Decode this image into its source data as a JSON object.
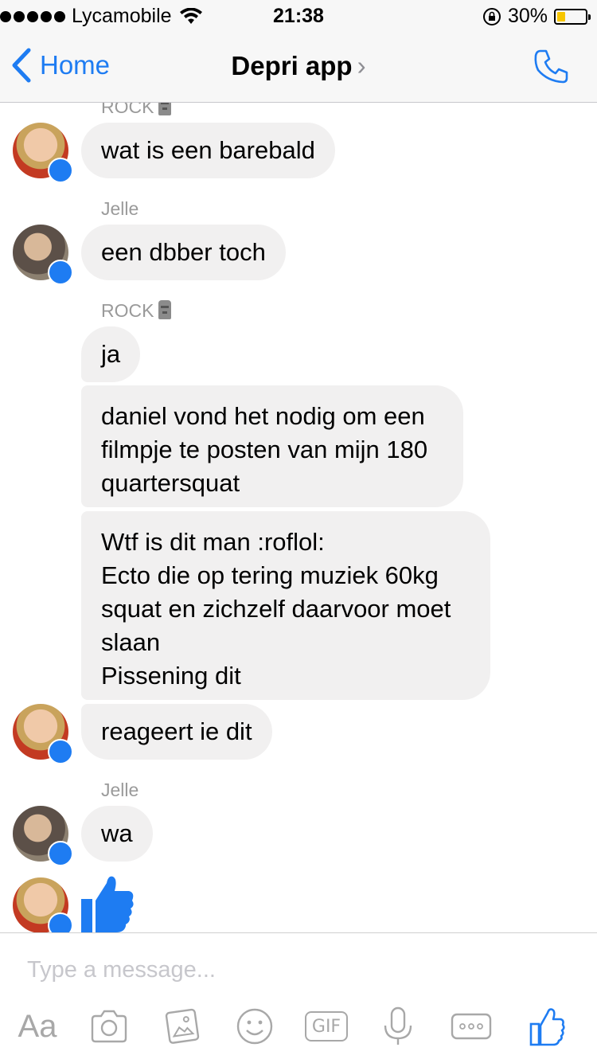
{
  "status_bar": {
    "carrier": "Lycamobile",
    "time": "21:38",
    "battery_percent_label": "30%",
    "battery_level": 0.3,
    "signal_icon": "signal-dots-icon",
    "wifi_icon": "wifi-icon",
    "lock_icon": "rotation-lock-icon"
  },
  "nav": {
    "back_label": "Home",
    "title": "Depri app",
    "chevron": "›",
    "call_icon": "phone-icon"
  },
  "messages": {
    "top_cut_sender": "ROCK",
    "rock_label": "ROCK",
    "jelle_label": "Jelle",
    "m1": "wat is een barebald",
    "m2": "een dbber toch",
    "m3": "ja",
    "m4": [
      "daniel vond het nodig om een",
      "filmpje te posten van mijn 180",
      "quartersquat"
    ],
    "m5": [
      "Wtf is dit man :roflol:",
      "Ecto die op tering muziek 60kg",
      "squat en zichzelf daarvoor moet",
      "slaan",
      "Pissening dit"
    ],
    "m6": "reageert ie dit",
    "m7": "wa",
    "m8_icon": "thumbs-up-icon"
  },
  "composer": {
    "placeholder": "Type a message...",
    "aa_label": "Aa",
    "gif_label": "GIF",
    "icons": [
      "camera-icon",
      "gallery-icon",
      "emoji-icon",
      "gif-icon",
      "microphone-icon",
      "more-icon",
      "like-icon"
    ]
  },
  "colors": {
    "accent": "#1e7cf2",
    "bubble": "#f1f0f0",
    "bar": "#f7f7f7",
    "battery": "#f7c600"
  }
}
